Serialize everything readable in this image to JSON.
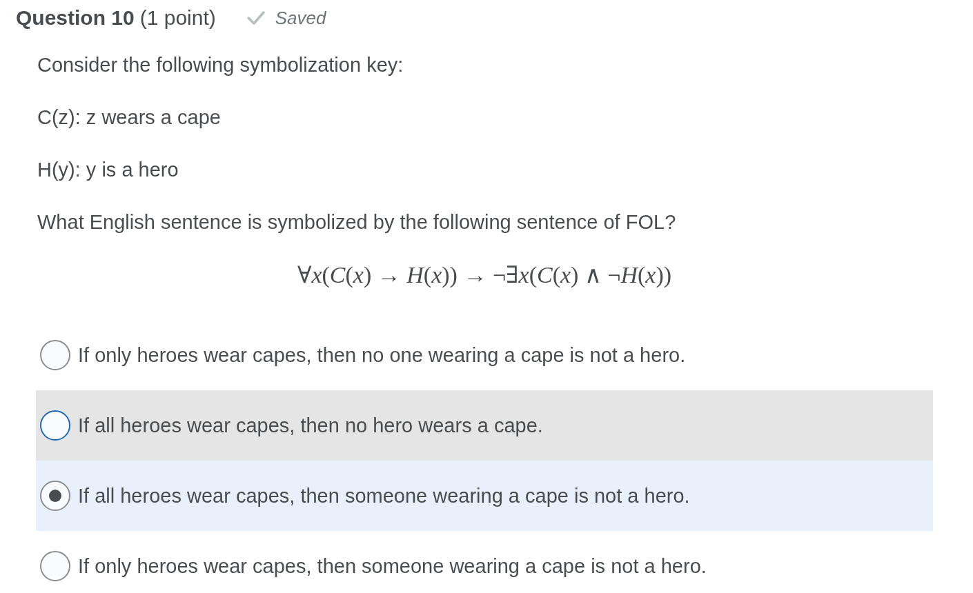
{
  "question": {
    "title": "Question 10",
    "points": "(1 point)",
    "status": "Saved"
  },
  "paragraphs": [
    "Consider the following symbolization key:",
    "C(z): z wears a cape",
    "H(y): y is a hero",
    "What English sentence is symbolized by the following sentence of FOL?"
  ],
  "formula": "∀*x*(*C*(*x*) → *H*(*x*)) → ¬∃*x*(*C*(*x*) ∧ ¬*H*(*x*))",
  "options": [
    {
      "label": "If only heroes wear capes, then no one wearing a cape is not a hero.",
      "selected": false,
      "focused": false
    },
    {
      "label": "If all heroes wear capes, then no hero wears a cape.",
      "selected": false,
      "focused": true
    },
    {
      "label": "If all heroes wear capes, then someone wearing a cape is not a hero.",
      "selected": true,
      "focused": false
    },
    {
      "label": "If only heroes wear capes, then someone wearing a cape is not a hero.",
      "selected": false,
      "focused": false
    }
  ]
}
